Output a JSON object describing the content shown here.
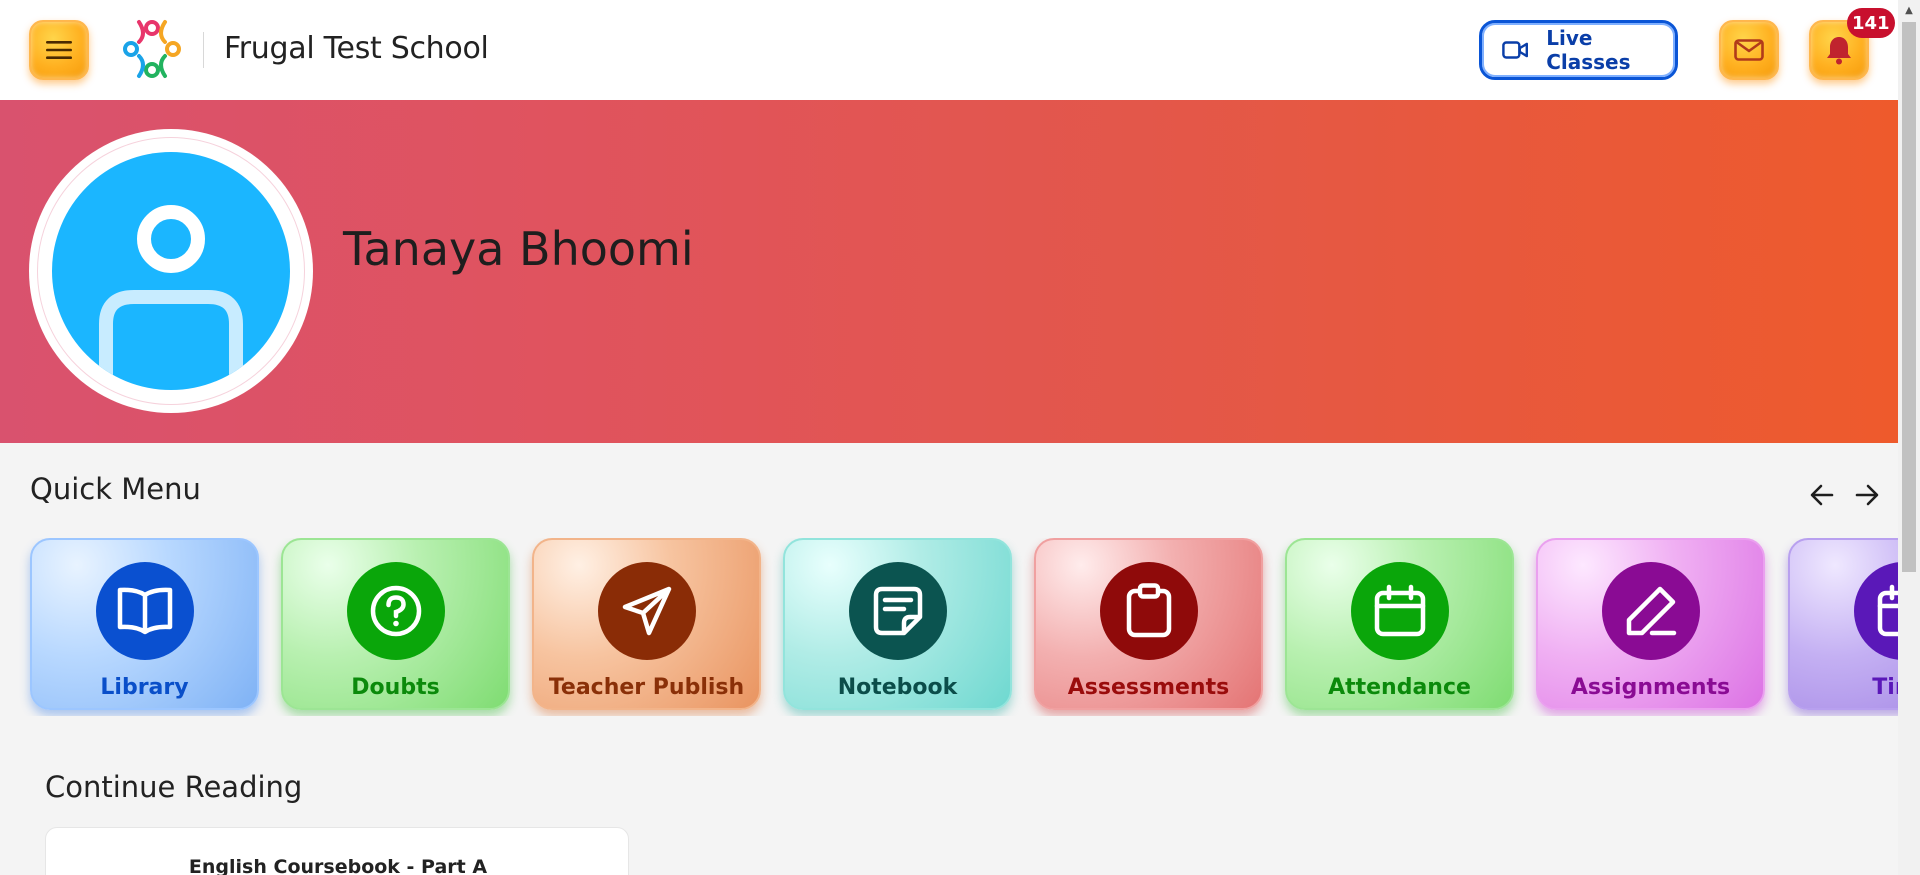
{
  "header": {
    "brand_name": "Frugal Test School",
    "live_label": "Live Classes",
    "notification_count": "141"
  },
  "profile": {
    "name": "Tanaya Bhoomi"
  },
  "quick_menu": {
    "title": "Quick Menu",
    "items": [
      {
        "label": "Library",
        "icon": "book-icon"
      },
      {
        "label": "Doubts",
        "icon": "question-icon"
      },
      {
        "label": "Teacher Publish",
        "icon": "send-icon"
      },
      {
        "label": "Notebook",
        "icon": "note-icon"
      },
      {
        "label": "Assessments",
        "icon": "clipboard-icon"
      },
      {
        "label": "Attendance",
        "icon": "calendar-icon"
      },
      {
        "label": "Assignments",
        "icon": "pen-icon"
      },
      {
        "label": "Time",
        "icon": "calendar-icon"
      }
    ]
  },
  "continue_reading": {
    "title": "Continue Reading",
    "book_title": "English Coursebook - Part A"
  },
  "colors": {
    "accent_orange": "#ffb020",
    "live_blue": "#0a55d6",
    "badge_red": "#c8102e",
    "avatar_blue": "#1bb6ff"
  }
}
